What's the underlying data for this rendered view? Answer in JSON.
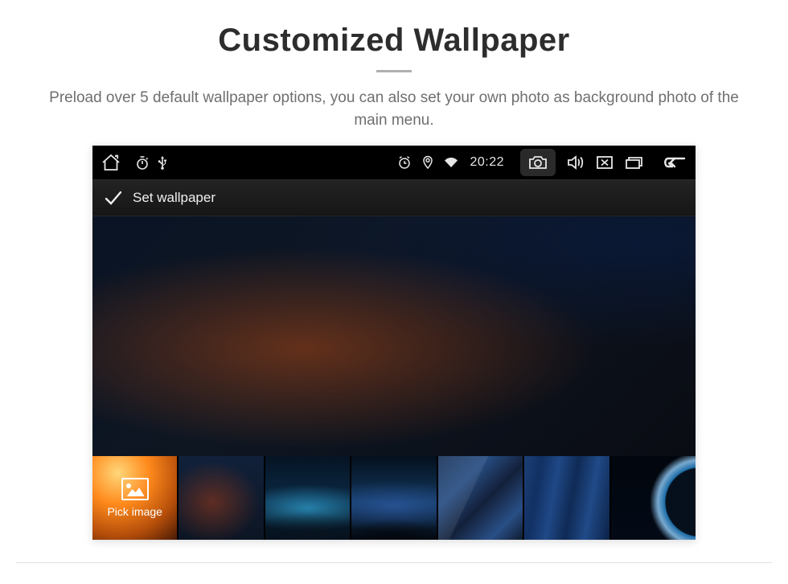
{
  "page": {
    "title": "Customized Wallpaper",
    "subtitle": "Preload over 5 default wallpaper options, you can also set your own photo as background photo of the main menu."
  },
  "statusbar": {
    "time": "20:22"
  },
  "actionbar": {
    "set_wallpaper_label": "Set wallpaper"
  },
  "thumbs": {
    "pick_image_label": "Pick image"
  }
}
